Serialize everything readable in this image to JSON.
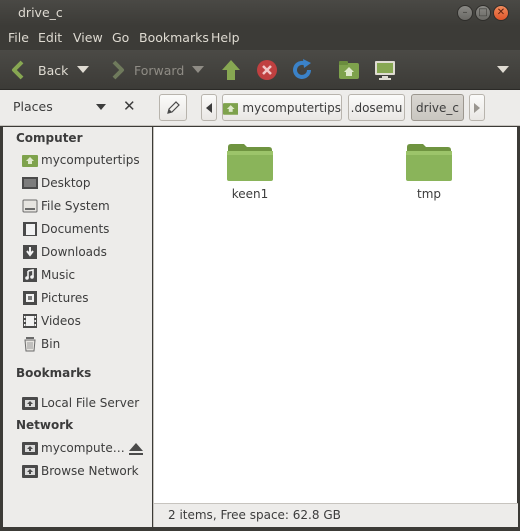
{
  "window": {
    "title": "drive_c"
  },
  "menu": {
    "items": [
      "File",
      "Edit",
      "View",
      "Go",
      "Bookmarks",
      "Help"
    ]
  },
  "toolbar": {
    "back_label": "Back",
    "forward_label": "Forward"
  },
  "location": {
    "places_label": "Places",
    "crumbs": [
      "mycomputertips",
      ".dosemu",
      "drive_c"
    ]
  },
  "sidebar": {
    "computer_heading": "Computer",
    "computer_items": [
      {
        "label": "mycomputertips",
        "icon": "home-folder-icon"
      },
      {
        "label": "Desktop",
        "icon": "desktop-icon"
      },
      {
        "label": "File System",
        "icon": "drive-icon"
      },
      {
        "label": "Documents",
        "icon": "documents-icon"
      },
      {
        "label": "Downloads",
        "icon": "downloads-icon"
      },
      {
        "label": "Music",
        "icon": "music-icon"
      },
      {
        "label": "Pictures",
        "icon": "pictures-icon"
      },
      {
        "label": "Videos",
        "icon": "videos-icon"
      },
      {
        "label": "Bin",
        "icon": "trash-icon"
      }
    ],
    "bookmarks_heading": "Bookmarks",
    "bookmark_items": [
      {
        "label": "Local File Server",
        "icon": "network-folder-icon"
      }
    ],
    "network_heading": "Network",
    "network_items": [
      {
        "label": "mycompute…",
        "icon": "network-folder-icon"
      },
      {
        "label": "Browse Network",
        "icon": "network-folder-icon"
      }
    ]
  },
  "files": [
    {
      "name": "keen1"
    },
    {
      "name": "tmp"
    }
  ],
  "status": {
    "text": "2 items, Free space: 62.8 GB"
  },
  "colors": {
    "accent_green": "#87a752",
    "folder_green": "#8ab45a",
    "stop_red": "#d94141",
    "reload_blue": "#3b82c8"
  }
}
